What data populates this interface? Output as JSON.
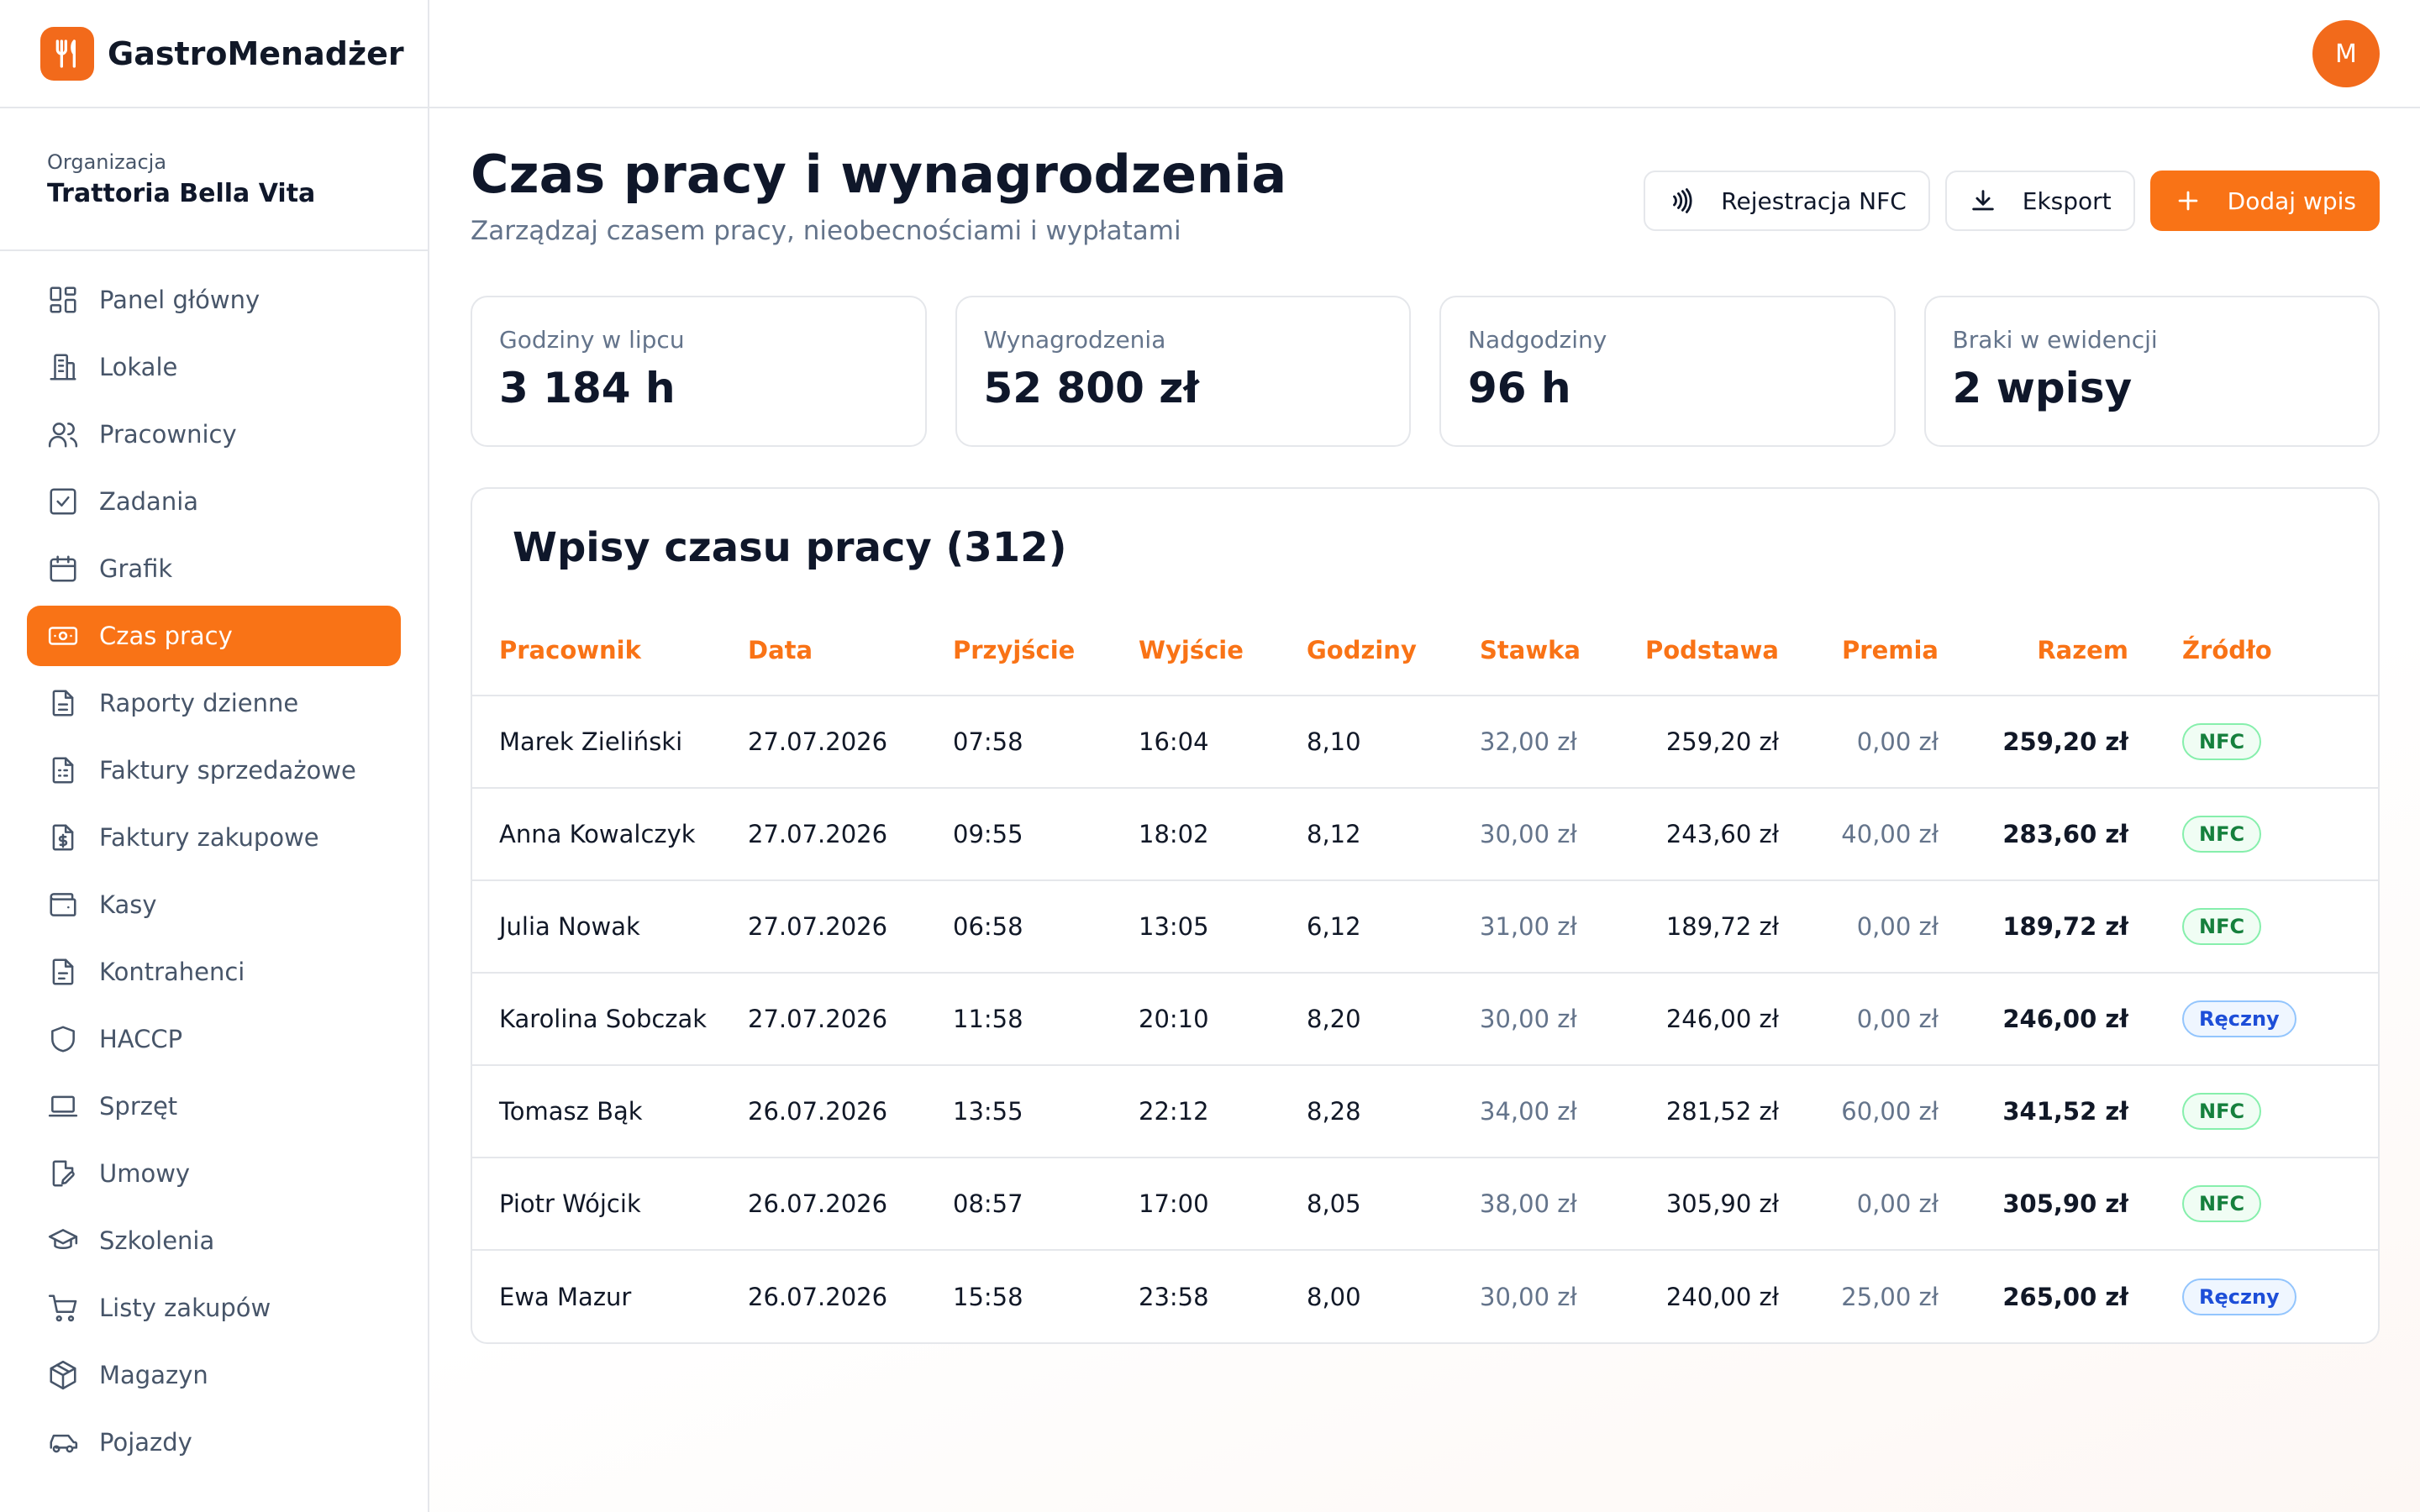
{
  "app": {
    "name": "GastroMenadżer",
    "avatar_initial": "M"
  },
  "organization": {
    "label": "Organizacja",
    "name": "Trattoria Bella Vita"
  },
  "sidebar": {
    "items": [
      {
        "label": "Panel główny",
        "icon": "dashboard-icon"
      },
      {
        "label": "Lokale",
        "icon": "building-icon"
      },
      {
        "label": "Pracownicy",
        "icon": "users-icon"
      },
      {
        "label": "Zadania",
        "icon": "checkbox-icon"
      },
      {
        "label": "Grafik",
        "icon": "calendar-icon"
      },
      {
        "label": "Czas pracy",
        "icon": "time-card-icon",
        "active": true
      },
      {
        "label": "Raporty dzienne",
        "icon": "document-icon"
      },
      {
        "label": "Faktury sprzedażowe",
        "icon": "invoice-icon"
      },
      {
        "label": "Faktury zakupowe",
        "icon": "dollar-document-icon"
      },
      {
        "label": "Kasy",
        "icon": "wallet-icon"
      },
      {
        "label": "Kontrahenci",
        "icon": "contacts-document-icon"
      },
      {
        "label": "HACCP",
        "icon": "shield-icon"
      },
      {
        "label": "Sprzęt",
        "icon": "laptop-icon"
      },
      {
        "label": "Umowy",
        "icon": "contract-icon"
      },
      {
        "label": "Szkolenia",
        "icon": "graduation-cap-icon"
      },
      {
        "label": "Listy zakupów",
        "icon": "cart-icon"
      },
      {
        "label": "Magazyn",
        "icon": "box-icon"
      },
      {
        "label": "Pojazdy",
        "icon": "car-icon"
      }
    ]
  },
  "page": {
    "title": "Czas pracy i wynagrodzenia",
    "subtitle": "Zarządzaj czasem pracy, nieobecnościami i wypłatami"
  },
  "actions": {
    "nfc_label": "Rejestracja NFC",
    "export_label": "Eksport",
    "add_label": "Dodaj wpis"
  },
  "stats": [
    {
      "label": "Godziny w lipcu",
      "value": "3 184 h"
    },
    {
      "label": "Wynagrodzenia",
      "value": "52 800 zł"
    },
    {
      "label": "Nadgodziny",
      "value": "96 h"
    },
    {
      "label": "Braki w ewidencji",
      "value": "2 wpisy"
    }
  ],
  "table": {
    "title": "Wpisy czasu pracy (312)",
    "headers": {
      "employee": "Pracownik",
      "date": "Data",
      "in": "Przyjście",
      "out": "Wyjście",
      "hours": "Godziny",
      "rate": "Stawka",
      "base": "Podstawa",
      "bonus": "Premia",
      "total": "Razem",
      "source": "Źródło"
    },
    "rows": [
      {
        "employee": "Marek Zieliński",
        "date": "27.07.2026",
        "in": "07:58",
        "out": "16:04",
        "hours": "8,10",
        "rate": "32,00 zł",
        "base": "259,20 zł",
        "bonus": "0,00 zł",
        "total": "259,20 zł",
        "source": "NFC",
        "source_type": "nfc"
      },
      {
        "employee": "Anna Kowalczyk",
        "date": "27.07.2026",
        "in": "09:55",
        "out": "18:02",
        "hours": "8,12",
        "rate": "30,00 zł",
        "base": "243,60 zł",
        "bonus": "40,00 zł",
        "total": "283,60 zł",
        "source": "NFC",
        "source_type": "nfc"
      },
      {
        "employee": "Julia Nowak",
        "date": "27.07.2026",
        "in": "06:58",
        "out": "13:05",
        "hours": "6,12",
        "rate": "31,00 zł",
        "base": "189,72 zł",
        "bonus": "0,00 zł",
        "total": "189,72 zł",
        "source": "NFC",
        "source_type": "nfc"
      },
      {
        "employee": "Karolina Sobczak",
        "date": "27.07.2026",
        "in": "11:58",
        "out": "20:10",
        "hours": "8,20",
        "rate": "30,00 zł",
        "base": "246,00 zł",
        "bonus": "0,00 zł",
        "total": "246,00 zł",
        "source": "Ręczny",
        "source_type": "manual"
      },
      {
        "employee": "Tomasz Bąk",
        "date": "26.07.2026",
        "in": "13:55",
        "out": "22:12",
        "hours": "8,28",
        "rate": "34,00 zł",
        "base": "281,52 zł",
        "bonus": "60,00 zł",
        "total": "341,52 zł",
        "source": "NFC",
        "source_type": "nfc"
      },
      {
        "employee": "Piotr Wójcik",
        "date": "26.07.2026",
        "in": "08:57",
        "out": "17:00",
        "hours": "8,05",
        "rate": "38,00 zł",
        "base": "305,90 zł",
        "bonus": "0,00 zł",
        "total": "305,90 zł",
        "source": "NFC",
        "source_type": "nfc"
      },
      {
        "employee": "Ewa Mazur",
        "date": "26.07.2026",
        "in": "15:58",
        "out": "23:58",
        "hours": "8,00",
        "rate": "30,00 zł",
        "base": "240,00 zł",
        "bonus": "25,00 zł",
        "total": "265,00 zł",
        "source": "Ręczny",
        "source_type": "manual"
      }
    ]
  },
  "colors": {
    "accent": "#f97316",
    "brand": "#f26a1b",
    "nfc": "#15803d",
    "manual": "#1d4ed8"
  }
}
